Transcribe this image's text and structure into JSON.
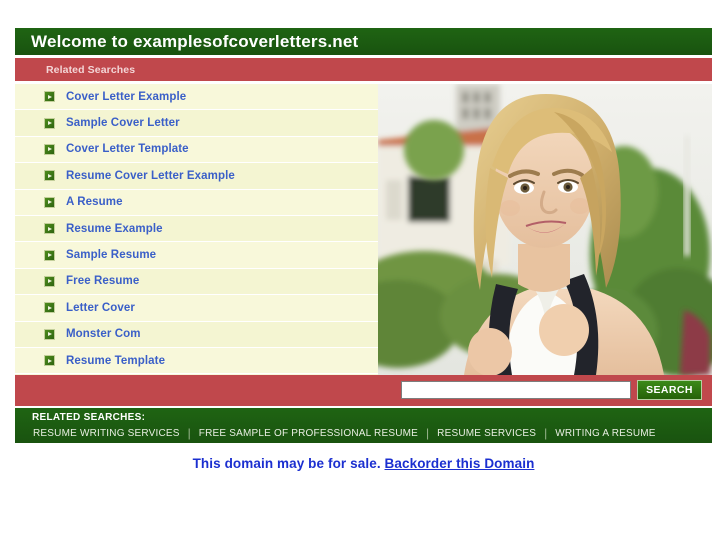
{
  "header": {
    "title": "Welcome to examplesofcoverletters.net"
  },
  "related_bar": {
    "label": "Related Searches"
  },
  "links": [
    {
      "label": "Cover Letter Example"
    },
    {
      "label": "Sample Cover Letter"
    },
    {
      "label": "Cover Letter Template"
    },
    {
      "label": "Resume Cover Letter Example"
    },
    {
      "label": "A Resume"
    },
    {
      "label": "Resume Example"
    },
    {
      "label": "Sample Resume"
    },
    {
      "label": "Free Resume"
    },
    {
      "label": "Letter Cover"
    },
    {
      "label": "Monster Com"
    },
    {
      "label": "Resume Template"
    }
  ],
  "photo": {
    "alt": "Smiling blonde female student wearing a backpack in front of a building with hedges"
  },
  "search": {
    "value": "",
    "placeholder": "",
    "button_label": "SEARCH"
  },
  "footer": {
    "heading": "RELATED SEARCHES:",
    "links": [
      {
        "label": "RESUME WRITING SERVICES"
      },
      {
        "label": "FREE SAMPLE OF PROFESSIONAL RESUME"
      },
      {
        "label": "RESUME SERVICES"
      },
      {
        "label": "WRITING A RESUME"
      }
    ],
    "separator": "|"
  },
  "sale_notice": {
    "text": "This domain may be for sale.",
    "link_label": "Backorder this Domain"
  },
  "colors": {
    "green_dark": "#1d5c12",
    "red": "#c0484c",
    "list_bg": "#f8f8da",
    "link_blue": "#3a5fc8",
    "sale_blue": "#1b2fd0",
    "button_green": "#2e7512"
  }
}
